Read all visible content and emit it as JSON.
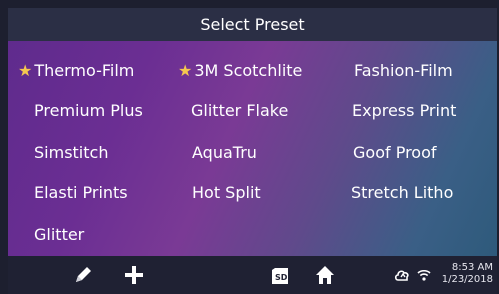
{
  "header": {
    "title": "Select Preset"
  },
  "presets": [
    {
      "label": "Thermo-Film",
      "starred": true
    },
    {
      "label": "3M Scotchlite",
      "starred": true
    },
    {
      "label": "Fashion-Film",
      "starred": false
    },
    {
      "label": "Premium Plus",
      "starred": false
    },
    {
      "label": "Glitter Flake",
      "starred": false
    },
    {
      "label": "Express Print",
      "starred": false
    },
    {
      "label": "Simstitch",
      "starred": false
    },
    {
      "label": "AquaTru",
      "starred": false
    },
    {
      "label": "Goof Proof",
      "starred": false
    },
    {
      "label": "Elasti Prints",
      "starred": false
    },
    {
      "label": "Hot Split",
      "starred": false
    },
    {
      "label": "Stretch Litho",
      "starred": false
    },
    {
      "label": "Glitter",
      "starred": false
    }
  ],
  "icons": {
    "star": "star-icon",
    "edit": "pencil-icon",
    "add": "plus-icon",
    "sd": "sd-card-icon",
    "home": "home-icon",
    "cloud": "cloud-sync-icon",
    "wifi": "wifi-icon"
  },
  "footer": {
    "time": "8:53 AM",
    "date": "1/23/2018"
  },
  "colors": {
    "star": "#f5c84f",
    "title_bar": "#2b2f45",
    "bottom_bar": "#1f2133"
  }
}
